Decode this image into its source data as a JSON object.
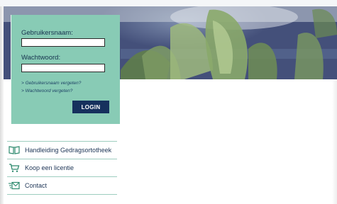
{
  "login": {
    "username_label": "Gebruikersnaam:",
    "username_value": "",
    "password_label": "Wachtwoord:",
    "password_value": "",
    "forgot_username": "> Gebruikersnaam vergeten?",
    "forgot_password": "> Wachtwoord vergeten?",
    "login_button": "LOGIN"
  },
  "menu": {
    "items": [
      {
        "label": "Handleiding Gedragsortotheek",
        "icon": "book-icon"
      },
      {
        "label": "Koop een licentie",
        "icon": "shopping-cart-icon"
      },
      {
        "label": "Contact",
        "icon": "mail-icon"
      }
    ]
  },
  "colors": {
    "panel": "#88cbb5",
    "button": "#16305d",
    "menu_text": "#1d3556",
    "menu_divider": "#9dcdbf",
    "icon": "#2d8a6e"
  }
}
